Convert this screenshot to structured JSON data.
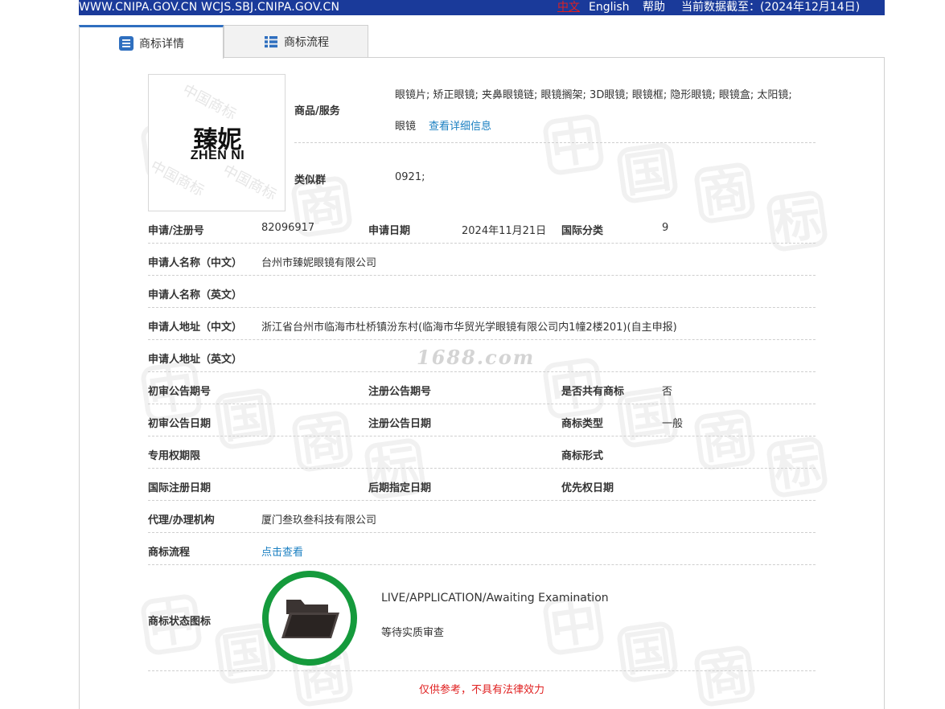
{
  "topbar": {
    "site": "WWW.CNIPA.GOV.CN WCJS.SBJ.CNIPA.GOV.CN",
    "lang_zh": "中文",
    "lang_en": "English",
    "help": "帮助",
    "data_as_of": "当前数据截至：(2024年12月14日)"
  },
  "tabs": [
    {
      "label": "商标详情",
      "active": true,
      "icon": "list-doc-icon"
    },
    {
      "label": "商标流程",
      "active": false,
      "icon": "list-grid-icon"
    }
  ],
  "logo": {
    "text_cn": "臻妮",
    "text_en": "ZHEN NI",
    "watermark": "中国商标"
  },
  "goods": {
    "label": "商品/服务",
    "line1": "眼镜片; 矫正眼镜; 夹鼻眼镜链; 眼镜搁架; 3D眼镜; 眼镜框; 隐形眼镜; 眼镜盒; 太阳镜;",
    "line2": "眼镜",
    "detail_link": "查看详细信息"
  },
  "similar_group": {
    "label": "类似群",
    "value": "0921;"
  },
  "fields": {
    "reg_no": {
      "label": "申请/注册号",
      "value": "82096917"
    },
    "app_date": {
      "label": "申请日期",
      "value": "2024年11月21日"
    },
    "intl_class": {
      "label": "国际分类",
      "value": "9"
    },
    "applicant_cn": {
      "label": "申请人名称（中文）",
      "value": "台州市臻妮眼镜有限公司"
    },
    "applicant_en": {
      "label": "申请人名称（英文）",
      "value": ""
    },
    "address_cn": {
      "label": "申请人地址（中文）",
      "value": "浙江省台州市临海市杜桥镇汾东村(临海市华贸光学眼镜有限公司内1幢2楼201)(自主申报)"
    },
    "address_en": {
      "label": "申请人地址（英文）",
      "value": ""
    },
    "prelim_no": {
      "label": "初审公告期号",
      "value": ""
    },
    "reg_pub_no": {
      "label": "注册公告期号",
      "value": ""
    },
    "shared": {
      "label": "是否共有商标",
      "value": "否"
    },
    "prelim_date": {
      "label": "初审公告日期",
      "value": ""
    },
    "reg_pub_date": {
      "label": "注册公告日期",
      "value": ""
    },
    "tm_type": {
      "label": "商标类型",
      "value": "一般"
    },
    "exclusive_term": {
      "label": "专用权期限",
      "value": ""
    },
    "tm_form": {
      "label": "商标形式",
      "value": ""
    },
    "intl_reg_date": {
      "label": "国际注册日期",
      "value": ""
    },
    "later_date": {
      "label": "后期指定日期",
      "value": ""
    },
    "priority_date": {
      "label": "优先权日期",
      "value": ""
    },
    "agent": {
      "label": "代理/办理机构",
      "value": "厦门叁玖叁科技有限公司"
    },
    "flow": {
      "label": "商标流程",
      "value": "点击查看"
    }
  },
  "status": {
    "label": "商标状态图标",
    "en": "LIVE/APPLICATION/Awaiting Examination",
    "cn": "等待实质审查",
    "icon": "folder-open-icon",
    "ring_color": "#159a3c"
  },
  "watermark_1688": "1688.com",
  "watermark_chars": [
    "中",
    "国",
    "商",
    "标"
  ],
  "disclaimer": "仅供参考，不具有法律效力",
  "colors": {
    "topbar": "#1a3a9a",
    "link": "#1a7fc1",
    "warning": "#e02020",
    "tab_accent": "#2f6fbf"
  }
}
